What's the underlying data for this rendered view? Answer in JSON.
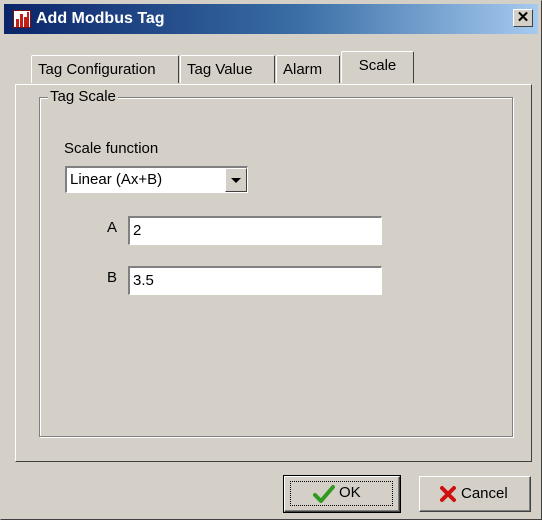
{
  "window": {
    "title": "Add Modbus Tag",
    "close_label": "✕"
  },
  "tabs": [
    {
      "label": "Tag Configuration",
      "active": false
    },
    {
      "label": "Tag Value",
      "active": false
    },
    {
      "label": "Alarm",
      "active": false
    },
    {
      "label": "Scale",
      "active": true
    }
  ],
  "scale": {
    "group_title": "Tag Scale",
    "function_label": "Scale function",
    "function_value": "Linear (Ax+B)",
    "a_label": "A",
    "a_value": "2",
    "b_label": "B",
    "b_value": "3.5"
  },
  "buttons": {
    "ok_label": "OK",
    "cancel_label": "Cancel"
  },
  "colors": {
    "title_gradient_start": "#0a246a",
    "title_gradient_end": "#a6caf0",
    "dialog_face": "#d4d0c8",
    "ok_check": "#2e9a1e",
    "cancel_x": "#d01010"
  }
}
